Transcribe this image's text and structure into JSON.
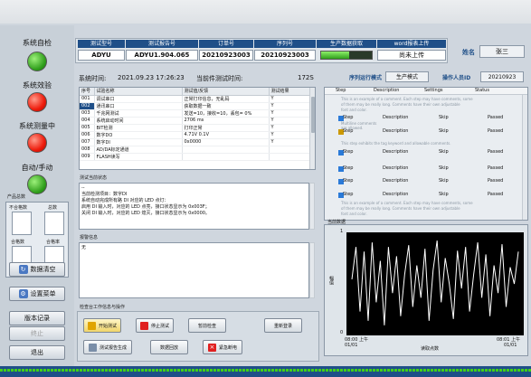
{
  "left_panel": {
    "lamps": [
      {
        "label": "系统自检",
        "state": "green"
      },
      {
        "label": "系统效验",
        "state": "red"
      },
      {
        "label": "系统测量中",
        "state": "red"
      },
      {
        "label": "自动/手动",
        "state": "green"
      }
    ],
    "counts_title": "产品总数",
    "counts": [
      {
        "label": "不合格数",
        "value": ""
      },
      {
        "label": "总数",
        "value": ""
      },
      {
        "label": "合格数",
        "value": ""
      },
      {
        "label": "合格率",
        "value": ""
      }
    ],
    "buttons": {
      "clear": "数据清空",
      "settings": "设置菜单",
      "version": "版本记录",
      "stop": "终止",
      "exit": "退出"
    }
  },
  "header": {
    "columns": [
      "测试型号",
      "测试报告号",
      "订单号",
      "序列号",
      "生产数据获取",
      "word报表上传"
    ],
    "values": [
      "ADYU",
      "ADYU1.904.065",
      "20210923003",
      "20210923003",
      "",
      "尚未上传"
    ],
    "name_label": "姓名",
    "name_value": "张三",
    "serial_mode_label": "序列运行模式",
    "serial_mode_value": "生产模式",
    "operator_label": "操作人员ID",
    "operator_value": "20210923"
  },
  "info": {
    "system_time_label": "系统时间:",
    "system_time_value": "2021.09.23  17:26:23",
    "current_test_label": "当前件测试时间:",
    "current_test_value": "172S"
  },
  "test_table": {
    "headers": [
      "序号",
      "试验名称",
      "测试值/反馈",
      "测试结果"
    ],
    "rows": [
      [
        "001",
        "调试串口",
        "正常打印信息，无乱码",
        "Y"
      ],
      [
        "002",
        "通讯串口",
        "获取数据一致",
        "Y"
      ],
      [
        "003",
        "千兆网测试",
        "发送=10，接收=10，丢包= 0%",
        "Y"
      ],
      [
        "004",
        "系统启动时间",
        "2706 ms",
        "Y"
      ],
      [
        "005",
        "BIT检测",
        "打印正常",
        "Y"
      ],
      [
        "006",
        "数字DO",
        "4.71V     0.1V",
        "Y"
      ],
      [
        "007",
        "数字DI",
        "0x0000",
        "Y"
      ],
      [
        "008",
        "AD/DA标定通道",
        "",
        ""
      ],
      [
        "009",
        "FLASH读写",
        "",
        ""
      ]
    ],
    "selected_index": 1
  },
  "test_status": {
    "title": "测试当前状态",
    "lines": [
      "--",
      "当前检测项目：数字DI",
      "系统自动完成所有路 DI 对应的 LED 点灯：",
      "启用 DI 输入时，对应的 LED 点亮，接口状态显示为 0x003F；",
      "关闭 DI 输入时，对应的 LED 熄灭，接口状态显示为 0x0000。"
    ]
  },
  "error_info": {
    "title": "报警信息",
    "text": "无"
  },
  "ops": {
    "title": "检查台工作信息与操作",
    "buttons": [
      "开始测试",
      "停止测试",
      "暂前检查",
      "重新登录",
      "测试报告生成",
      "数据回放",
      "紧急断电"
    ]
  },
  "step_panel": {
    "headers": [
      "Step",
      "Description",
      "Settings",
      "Status"
    ],
    "rows": [
      {
        "step": "Step",
        "description": "Description",
        "settings": "Skip",
        "status": "Passed"
      },
      {
        "step": "Step",
        "description": "Description",
        "settings": "Skip",
        "status": "Passed"
      },
      {
        "step": "Step",
        "description": "Description",
        "settings": "Skip",
        "status": "Passed"
      },
      {
        "step": "Step",
        "description": "Description",
        "settings": "Skip",
        "status": "Passed"
      },
      {
        "step": "Step",
        "description": "Description",
        "settings": "Skip",
        "status": "Passed"
      },
      {
        "step": "Step",
        "description": "Description",
        "settings": "Skip",
        "status": "Passed"
      }
    ],
    "gray_lines": [
      "This is an example of a comment. Each step may have comments, some",
      "of them may be really long. Comments have their own adjustable",
      "font and color.",
      "Multiline comments",
      "are allowed.",
      "This step exhibits the tag keyword and allowable comments.",
      "This is an example of a comment. Each step may have comments, some",
      "of them may be really long. Comments have their own adjustable",
      "font and color."
    ]
  },
  "graph": {
    "title": "当前数据",
    "ylabel": "幅值",
    "xlabel": "读取点数",
    "x_start_time": "08:00 上午",
    "x_start_date": "01/01",
    "x_end_time": "08:01 上午",
    "x_end_date": "01/01",
    "yticks": [
      "1",
      "0"
    ]
  },
  "chart_data": {
    "type": "line",
    "title": "当前数据",
    "xlabel": "读取点数",
    "ylabel": "幅值",
    "ylim": [
      0,
      1
    ],
    "x": [
      "08:00 上午 01/01",
      "08:01 上午 01/01"
    ],
    "series": [
      {
        "values": [
          0.55,
          0.9,
          0.2,
          0.85,
          0.1,
          0.95,
          0.3,
          0.75,
          0.05,
          0.9,
          0.4,
          0.8,
          0.15,
          0.6,
          0.92,
          0.25,
          0.7,
          0.35,
          0.88,
          0.1,
          0.65,
          0.97,
          0.3,
          0.78,
          0.5,
          0.12,
          0.86,
          0.45,
          0.9,
          0.2,
          0.6,
          0.95,
          0.35,
          0.82,
          0.15,
          0.7,
          0.4,
          0.93,
          0.25,
          0.68,
          0.5,
          0.85
        ]
      }
    ]
  }
}
